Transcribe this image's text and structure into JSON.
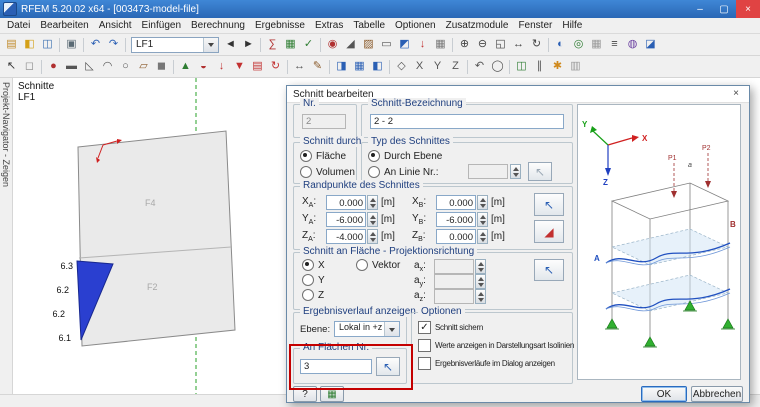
{
  "window": {
    "title": "RFEM 5.20.02 x64 - [003473-model-file]",
    "controls": {
      "minimize": "–",
      "maximize": "▢",
      "close": "×"
    }
  },
  "menu": {
    "items": [
      "Datei",
      "Bearbeiten",
      "Ansicht",
      "Einfügen",
      "Berechnung",
      "Ergebnisse",
      "Extras",
      "Tabelle",
      "Optionen",
      "Zusatzmodule",
      "Fenster",
      "Hilfe"
    ]
  },
  "toolbar": {
    "load_case": "LF1",
    "row1a": [
      {
        "name": "new",
        "glyph": "▤",
        "color": "#c08a2a"
      },
      {
        "name": "open",
        "glyph": "◧",
        "color": "#d4a017"
      },
      {
        "name": "save",
        "glyph": "◫",
        "color": "#3a6fb0"
      },
      {
        "sep": true
      },
      {
        "name": "print",
        "glyph": "▣",
        "color": "#5a6a74"
      },
      {
        "sep": true
      },
      {
        "name": "undo",
        "glyph": "↶",
        "color": "#2a5fb4"
      },
      {
        "name": "redo",
        "glyph": "↷",
        "color": "#2a5fb4"
      },
      {
        "sep": true
      }
    ],
    "row1b": [
      {
        "name": "prev-load-case",
        "glyph": "◄",
        "color": "#333333"
      },
      {
        "name": "next-load-case",
        "glyph": "►",
        "color": "#333333"
      },
      {
        "sep": true
      },
      {
        "name": "calculate",
        "glyph": "∑",
        "color": "#b03030"
      },
      {
        "name": "show-results",
        "glyph": "▦",
        "color": "#2e7d32"
      },
      {
        "name": "check",
        "glyph": "✓",
        "color": "#2e7d32"
      },
      {
        "sep": true
      },
      {
        "name": "node",
        "glyph": "◉",
        "color": "#b03030"
      },
      {
        "name": "line",
        "glyph": "◢",
        "color": "#555555"
      },
      {
        "name": "surface",
        "glyph": "▨",
        "color": "#8a5a2a"
      },
      {
        "name": "opening",
        "glyph": "▭",
        "color": "#555555"
      },
      {
        "name": "section",
        "glyph": "◩",
        "color": "#2a5fb4"
      },
      {
        "name": "load",
        "glyph": "↓",
        "color": "#c23030"
      },
      {
        "name": "mesh",
        "glyph": "▦",
        "color": "#777777"
      },
      {
        "sep": true
      },
      {
        "name": "zoom-in",
        "glyph": "⊕",
        "color": "#444444"
      },
      {
        "name": "zoom-out",
        "glyph": "⊖",
        "color": "#444444"
      },
      {
        "name": "zoom-window",
        "glyph": "◱",
        "color": "#444444"
      },
      {
        "name": "pan",
        "glyph": "↔",
        "color": "#444444"
      },
      {
        "name": "rotate-view",
        "glyph": "↻",
        "color": "#444444"
      },
      {
        "sep": true
      },
      {
        "name": "render-mode",
        "glyph": "◐",
        "color": "#2a5fb4"
      },
      {
        "name": "numbering",
        "glyph": "◎",
        "color": "#2e7d32"
      },
      {
        "name": "display-grid",
        "glyph": "▦",
        "color": "#999999"
      },
      {
        "name": "layers",
        "glyph": "≡",
        "color": "#444444"
      },
      {
        "name": "visibility",
        "glyph": "◍",
        "color": "#6a3fa0"
      },
      {
        "name": "clipping",
        "glyph": "◪",
        "color": "#2a5fb4"
      }
    ],
    "row2": [
      {
        "name": "select",
        "glyph": "↖",
        "color": "#333333"
      },
      {
        "name": "deselect",
        "glyph": "◻",
        "color": "#888888"
      },
      {
        "sep": true
      },
      {
        "name": "insert-node",
        "glyph": "●",
        "color": "#b03030"
      },
      {
        "name": "insert-line",
        "glyph": "▬",
        "color": "#555555"
      },
      {
        "name": "polyline",
        "glyph": "◺",
        "color": "#555555"
      },
      {
        "name": "arc",
        "glyph": "◠",
        "color": "#555555"
      },
      {
        "name": "circle",
        "glyph": "○",
        "color": "#555555"
      },
      {
        "name": "insert-surface",
        "glyph": "▱",
        "color": "#8a5a2a"
      },
      {
        "name": "solid",
        "glyph": "◼",
        "color": "#777777"
      },
      {
        "sep": true
      },
      {
        "name": "support",
        "glyph": "▲",
        "color": "#2e7d32"
      },
      {
        "name": "hinge",
        "glyph": "◒",
        "color": "#b03030"
      },
      {
        "name": "nodal-load",
        "glyph": "↓",
        "color": "#c23030"
      },
      {
        "name": "line-load",
        "glyph": "▼",
        "color": "#c23030"
      },
      {
        "name": "area-load",
        "glyph": "▤",
        "color": "#c23030"
      },
      {
        "name": "moment-load",
        "glyph": "↻",
        "color": "#c23030"
      },
      {
        "sep": true
      },
      {
        "name": "dimension",
        "glyph": "↔",
        "color": "#555555"
      },
      {
        "name": "comment",
        "glyph": "✎",
        "color": "#8a5a2a"
      },
      {
        "sep": true
      },
      {
        "name": "project-navigator",
        "glyph": "◨",
        "color": "#2a5fb4"
      },
      {
        "name": "tables",
        "glyph": "▦",
        "color": "#2a5fb4"
      },
      {
        "name": "control-panel",
        "glyph": "◧",
        "color": "#2a5fb4"
      },
      {
        "sep": true
      },
      {
        "name": "isometric-view",
        "glyph": "◇",
        "color": "#555555"
      },
      {
        "name": "view-x",
        "glyph": "X",
        "color": "#555555"
      },
      {
        "name": "view-y",
        "glyph": "Y",
        "color": "#555555"
      },
      {
        "name": "view-z",
        "glyph": "Z",
        "color": "#555555"
      },
      {
        "sep": true
      },
      {
        "name": "previous-view",
        "glyph": "↶",
        "color": "#555555"
      },
      {
        "name": "full-view",
        "glyph": "◯",
        "color": "#555555"
      },
      {
        "sep": true
      },
      {
        "name": "work-plane",
        "glyph": "◫",
        "color": "#2e7d32"
      },
      {
        "name": "guidelines",
        "glyph": "∥",
        "color": "#555555"
      },
      {
        "name": "snap",
        "glyph": "✱",
        "color": "#d08a1e"
      },
      {
        "name": "background-color",
        "glyph": "▥",
        "color": "#999999"
      }
    ]
  },
  "navigator": {
    "tab_label": "Projekt-Navigator - Zeigen"
  },
  "canvas": {
    "title_line1": "Schnitte",
    "title_line2": "LF1",
    "section_values": [
      "6.3",
      "6.2",
      "6.2",
      "6.1"
    ],
    "face_labels": [
      "F4",
      "F2"
    ]
  },
  "glyphs": {
    "check": "✓",
    "pick": "↖",
    "pick2": "◢"
  },
  "dialog": {
    "title": "Schnitt bearbeiten",
    "close": "×",
    "nr": {
      "label": "Nr.",
      "value": "2"
    },
    "bezeichnung": {
      "label": "Schnitt-Bezeichnung",
      "value": "2 - 2"
    },
    "schnitt_durch": {
      "label": "Schnitt durch",
      "options": [
        {
          "label": "Fläche",
          "selected": true
        },
        {
          "label": "Volumen",
          "selected": false
        }
      ]
    },
    "typ": {
      "label": "Typ des Schnittes",
      "options": [
        {
          "label": "Durch Ebene",
          "selected": true
        },
        {
          "label": "An Linie Nr.:",
          "selected": false
        }
      ],
      "linie_value": ""
    },
    "randpunkte": {
      "label": "Randpunkte des Schnittes",
      "unit": "[m]",
      "fields": [
        {
          "pre": "X",
          "sub": "A",
          "post": ":",
          "value": "0.000"
        },
        {
          "pre": "Y",
          "sub": "A",
          "post": ":",
          "value": "-6.000"
        },
        {
          "pre": "Z",
          "sub": "A",
          "post": ":",
          "value": "-4.000"
        },
        {
          "pre": "X",
          "sub": "B",
          "post": ":",
          "value": "0.000"
        },
        {
          "pre": "Y",
          "sub": "B",
          "post": ":",
          "value": "-6.000"
        },
        {
          "pre": "Z",
          "sub": "B",
          "post": ":",
          "value": "0.000"
        }
      ]
    },
    "projektion": {
      "label": "Schnitt an Fläche - Projektionsrichtung",
      "axes": [
        {
          "label": "X",
          "selected": true
        },
        {
          "label": "Y",
          "selected": false
        },
        {
          "label": "Z",
          "selected": false
        }
      ],
      "vektor": {
        "label": "Vektor",
        "selected": false
      },
      "vector_fields": [
        {
          "pre": "a",
          "sub": "x",
          "post": ":",
          "value": ""
        },
        {
          "pre": "a",
          "sub": "y",
          "post": ":",
          "value": ""
        },
        {
          "pre": "a",
          "sub": "z",
          "post": ":",
          "value": ""
        }
      ]
    },
    "ergebnisverlauf": {
      "label": "Ergebnisverlauf anzeigen in",
      "ebene_label": "Ebene:",
      "ebene_value": "Lokal in +z"
    },
    "flaechen": {
      "label": "An Flächen Nr.",
      "value": "3"
    },
    "optionen": {
      "label": "Optionen",
      "checkboxes": [
        {
          "label": "Schnitt sichern",
          "checked": true
        },
        {
          "label": "Werte anzeigen in Darstellungsart Isolinien",
          "checked": false
        },
        {
          "label": "Ergebnisverläufe im Dialog anzeigen",
          "checked": false
        }
      ]
    },
    "buttons": {
      "help": "?",
      "display_icon": "▦",
      "ok": "OK",
      "cancel": "Abbrechen"
    },
    "graphic_labels": {
      "x": "X",
      "y": "Y",
      "z": "Z",
      "p1": "P1",
      "p2": "P2",
      "a": "a",
      "A": "A",
      "B": "B"
    }
  },
  "colors": {
    "annotation": "#c40000",
    "accent_blue": "#2f74c8",
    "result_blue": "#2a3fd0",
    "guideline_green": "#2aa02a"
  }
}
